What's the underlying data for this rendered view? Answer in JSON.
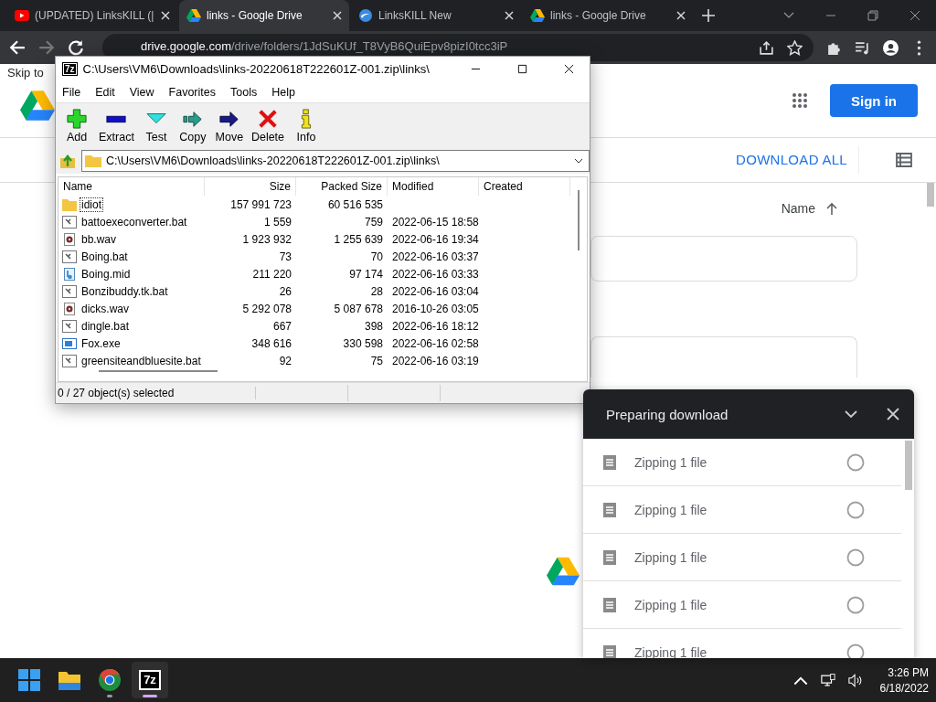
{
  "browser": {
    "tabs": [
      {
        "title": "(UPDATED) LinksKILL (|",
        "kind": "video",
        "selected": false
      },
      {
        "title": "links - Google Drive",
        "kind": "drive",
        "selected": true
      },
      {
        "title": "LinksKILL New",
        "kind": "site",
        "selected": false
      },
      {
        "title": "links - Google Drive",
        "kind": "drive",
        "selected": false
      }
    ],
    "address_host": "drive.google.com",
    "address_path": "/drive/folders/1JdSuKUf_T8VyB6QuiEpv8pizI0tcc3iP"
  },
  "drive": {
    "skip_link": "Skip to",
    "sign_in": "Sign in",
    "download_all": "DOWNLOAD ALL",
    "sort_label": "Name"
  },
  "archive_window": {
    "title": "C:\\Users\\VM6\\Downloads\\links-20220618T222601Z-001.zip\\links\\",
    "logo": "7z",
    "menu": [
      "File",
      "Edit",
      "View",
      "Favorites",
      "Tools",
      "Help"
    ],
    "toolbar": [
      {
        "label": "Add",
        "kind": "add"
      },
      {
        "label": "Extract",
        "kind": "extract"
      },
      {
        "label": "Test",
        "kind": "test"
      },
      {
        "label": "Copy",
        "kind": "copy"
      },
      {
        "label": "Move",
        "kind": "move"
      },
      {
        "label": "Delete",
        "kind": "delete"
      },
      {
        "label": "Info",
        "kind": "info"
      }
    ],
    "path": "C:\\Users\\VM6\\Downloads\\links-20220618T222601Z-001.zip\\links\\",
    "columns": [
      "Name",
      "Size",
      "Packed Size",
      "Modified",
      "Created"
    ],
    "rows": [
      {
        "kind": "folder",
        "name": "idiot",
        "size": "157 991 723",
        "packed": "60 516 535",
        "modified": "",
        "focused": true
      },
      {
        "kind": "bat",
        "name": "battoexeconverter.bat",
        "size": "1 559",
        "packed": "759",
        "modified": "2022-06-15 18:58",
        "focused": false
      },
      {
        "kind": "wav",
        "name": "bb.wav",
        "size": "1 923 932",
        "packed": "1 255 639",
        "modified": "2022-06-16 19:34",
        "focused": false
      },
      {
        "kind": "bat",
        "name": "Boing.bat",
        "size": "73",
        "packed": "70",
        "modified": "2022-06-16 03:37",
        "focused": false
      },
      {
        "kind": "mid",
        "name": "Boing.mid",
        "size": "211 220",
        "packed": "97 174",
        "modified": "2022-06-16 03:33",
        "focused": false
      },
      {
        "kind": "bat",
        "name": "Bonzibuddy.tk.bat",
        "size": "26",
        "packed": "28",
        "modified": "2022-06-16 03:04",
        "focused": false
      },
      {
        "kind": "wav",
        "name": "dicks.wav",
        "size": "5 292 078",
        "packed": "5 087 678",
        "modified": "2016-10-26 03:05",
        "focused": false
      },
      {
        "kind": "bat",
        "name": "dingle.bat",
        "size": "667",
        "packed": "398",
        "modified": "2022-06-16 18:12",
        "focused": false
      },
      {
        "kind": "exe",
        "name": "Fox.exe",
        "size": "348 616",
        "packed": "330 598",
        "modified": "2022-06-16 02:58",
        "focused": false
      },
      {
        "kind": "bat",
        "name": "greensiteandbluesite.bat",
        "size": "92",
        "packed": "75",
        "modified": "2022-06-16 03:19",
        "focused": false
      }
    ],
    "status": "0 / 27 object(s) selected"
  },
  "download_panel": {
    "title": "Preparing download",
    "items": [
      "Zipping 1 file",
      "Zipping 1 file",
      "Zipping 1 file",
      "Zipping 1 file",
      "Zipping 1 file"
    ]
  },
  "taskbar": {
    "apps": [
      {
        "kind": "start",
        "running": false,
        "selected": false
      },
      {
        "kind": "explorer",
        "running": false,
        "selected": false
      },
      {
        "kind": "chrome",
        "running": true,
        "selected": false
      },
      {
        "kind": "archiver",
        "label": "7z",
        "running": true,
        "selected": true
      }
    ],
    "time": "3:26 PM",
    "date": "6/18/2022"
  }
}
